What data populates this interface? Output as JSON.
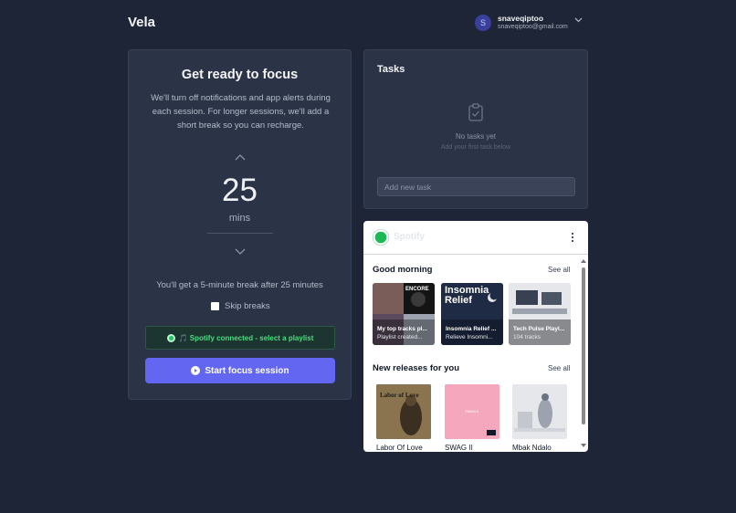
{
  "app": {
    "name": "Vela"
  },
  "user": {
    "initial": "S",
    "name": "snaveqiptoo",
    "email": "snaveqiptoo@gmail.com"
  },
  "focus": {
    "title": "Get ready to focus",
    "description": "We'll turn off notifications and app alerts during each session. For longer sessions, we'll add a short break so you can recharge.",
    "minutes": "25",
    "unit": "mins",
    "break_note": "You'll get a 5-minute break after 25 minutes",
    "skip_label": "Skip breaks",
    "spotify_status": "🎵 Spotify connected - select a playlist",
    "start_label": "Start focus session"
  },
  "tasks": {
    "title": "Tasks",
    "empty_title": "No tasks yet",
    "empty_sub": "Add your first task below",
    "input_placeholder": "Add new task"
  },
  "spotify": {
    "name": "Spotify",
    "greeting_title": "Good morning",
    "see_all": "See all",
    "playlists": [
      {
        "title": "My top tracks pl...",
        "sub": "Playlist created...",
        "cover_text": "ENCORE"
      },
      {
        "title": "Insomnia Relief ...",
        "sub": "Relieve Insomni...",
        "cover_text": "Insomnia Relief"
      },
      {
        "title": "Tech Pulse Playl...",
        "sub": "104 tracks"
      }
    ],
    "releases_title": "New releases for you",
    "releases": [
      {
        "title": "Labor Of Love",
        "cover_text": "Labor of Love"
      },
      {
        "title": "SWAG II",
        "cover_text": "SWAG II"
      },
      {
        "title": "Mbak Ndalo"
      }
    ]
  },
  "colors": {
    "background": "#1d2536",
    "panel": "#2b3447",
    "accent": "#6366f1",
    "spotify_green": "#1db954"
  }
}
